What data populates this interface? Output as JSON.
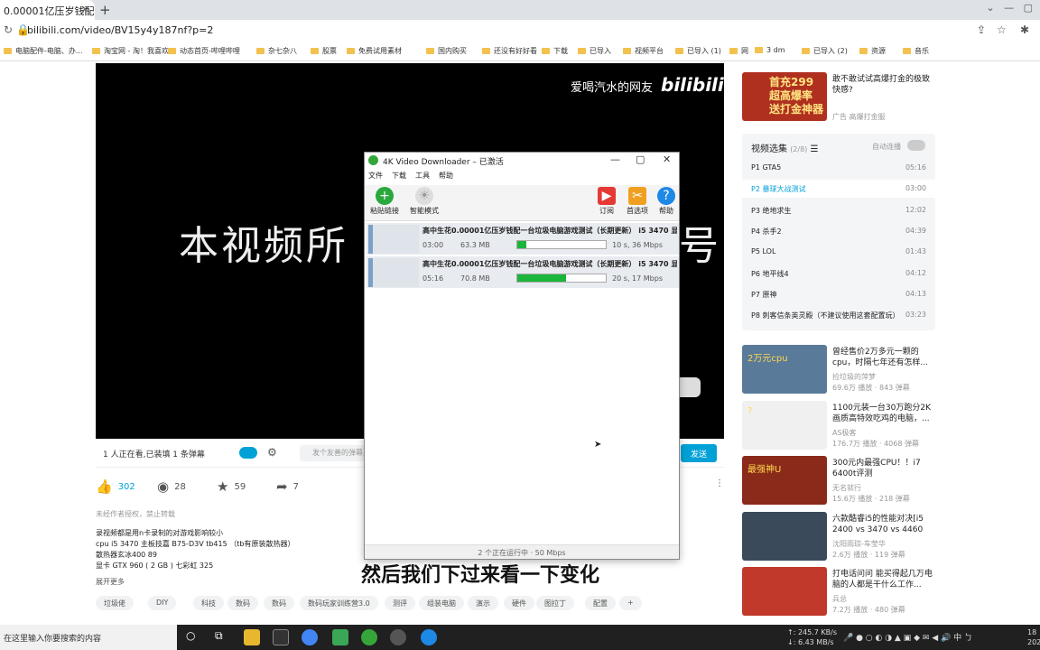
{
  "browser": {
    "tab_title": "0.00001亿压岁钱配一台",
    "url": "bilibili.com/video/BV15y4y187nf?p=2",
    "bookmarks": [
      "电脑配件-电脑、办...",
      "淘宝网 - 淘！我喜欢",
      "动态首页-哔哩哔哩",
      "杂七杂八",
      "股票",
      "免费试用素材",
      "国内购买",
      "还没有好好看",
      "下载",
      "已导入",
      "视频平台",
      "已导入 (1)",
      "网",
      "3 dm",
      "已导入 (2)",
      "资源",
      "音乐"
    ]
  },
  "player": {
    "watermark": "爱喝汽水的网友",
    "logo": "bilibili",
    "text": "本视频所",
    "text_tail": "号"
  },
  "danmaku": {
    "status": "1 人正在看,已装填 1 条弹幕",
    "placeholder": "发个友善的弹幕见证当下",
    "send": "发送"
  },
  "stats": {
    "likes": "302",
    "coins": "28",
    "favs": "59",
    "shares": "7"
  },
  "description": {
    "warning": "未经作者授权，禁止转载",
    "lines": [
      "录视频都是用n卡录制的对游戏影响较小",
      "cpu i5 3470 主板技嘉 B75-D3V tb415 （tb有原装散热器）",
      "散热器玄冰400 89",
      "显卡 GTX 960 ( 2 GB ) 七彩虹 325"
    ],
    "more": "展开更多"
  },
  "tags": [
    "垃圾佬",
    "DIY",
    "科技",
    "数码",
    "数码",
    "数码玩家训练营3.0",
    "测评",
    "组装电脑",
    "演示",
    "硬件",
    "图拉丁",
    "配置"
  ],
  "ad": {
    "img_line1": "首充299",
    "img_line2": "超高爆率",
    "img_line3": "送打金神器",
    "title": "敢不敢试试高爆打金的极致快感?",
    "sponsor": "广告 高爆打金服"
  },
  "playlist": {
    "header": "视频选集",
    "count": "(2/8)",
    "autoplay": "自动连播",
    "items": [
      {
        "p": "P1",
        "name": "GTA5",
        "dur": "05:16"
      },
      {
        "p": "P2",
        "name": "暴球大战测试",
        "dur": "03:00"
      },
      {
        "p": "P3",
        "name": "绝地求生",
        "dur": "12:02"
      },
      {
        "p": "P4",
        "name": "杀手2",
        "dur": "04:39"
      },
      {
        "p": "P5",
        "name": "LOL",
        "dur": "01:43"
      },
      {
        "p": "P6",
        "name": "地平线4",
        "dur": "04:12"
      },
      {
        "p": "P7",
        "name": "原神",
        "dur": "04:13"
      },
      {
        "p": "P8",
        "name": "刺客信条英灵殿（不建议使用这套配置玩）",
        "dur": "03:23"
      }
    ]
  },
  "recommend": [
    {
      "title": "曾经售价2万多元一颗的cpu，时隔七年还有怎样...",
      "up": "捡垃圾的萍梦",
      "meta": "69.6万 播放 · 843 弹幕",
      "thumb_text": "2万元cpu",
      "color": "#5a7a9a"
    },
    {
      "title": "1100元装一台30万跑分2K画质高特效吃鸡的电脑，...",
      "up": "AS极客",
      "meta": "176.7万 播放 · 4068 弹幕",
      "thumb_text": "?",
      "color": "#f0f0f0"
    },
    {
      "title": "300元内最强CPU！！i7 6400t评测",
      "up": "无名就行",
      "meta": "15.6万 播放 · 218 弹幕",
      "thumb_text": "最强神U",
      "color": "#8a2a1a"
    },
    {
      "title": "六款酷睿i5的性能对决[i5 2400 vs 3470 vs 4460 vs...",
      "up": "沈阳雨琮-车莹华",
      "meta": "2.6万 播放 · 119 弹幕",
      "thumb_text": "",
      "color": "#3a4a5a"
    },
    {
      "title": "打电话问问 能买得起几万电脑的人都是干什么工作...",
      "up": "兵总",
      "meta": "7.2万 播放 · 480 弹幕",
      "thumb_text": "",
      "color": "#c0392b"
    }
  ],
  "dialog": {
    "title": "4K Video Downloader – 已激活",
    "menu": [
      "文件",
      "下载",
      "工具",
      "帮助"
    ],
    "toolbar": {
      "paste": "粘贴链接",
      "smart": "智能模式",
      "subscribe": "订阅",
      "prefs": "首选项",
      "help": "帮助"
    },
    "downloads": [
      {
        "title": "高中生花0.00001亿压岁钱配一台垃圾电脑游戏测试（长期更新） i5 3470 显...",
        "duration": "03:00",
        "size": "63.3 MB",
        "progress": 0.1,
        "speed": "10 s, 36 Mbps"
      },
      {
        "title": "高中生花0.00001亿压岁钱配一台垃圾电脑游戏测试（长期更新） i5 3470 显...",
        "duration": "05:16",
        "size": "70.8 MB",
        "progress": 0.55,
        "speed": "20 s, 17 Mbps"
      }
    ],
    "status": "2 个正在运行中 · 50 Mbps"
  },
  "subtitle": "然后我们下过来看一下变化",
  "taskbar": {
    "search": "在这里输入你要搜索的内容",
    "up": "↑: 245.7 KB/s",
    "down": "↓: 6.43 MB/s",
    "clock": "18 202"
  }
}
